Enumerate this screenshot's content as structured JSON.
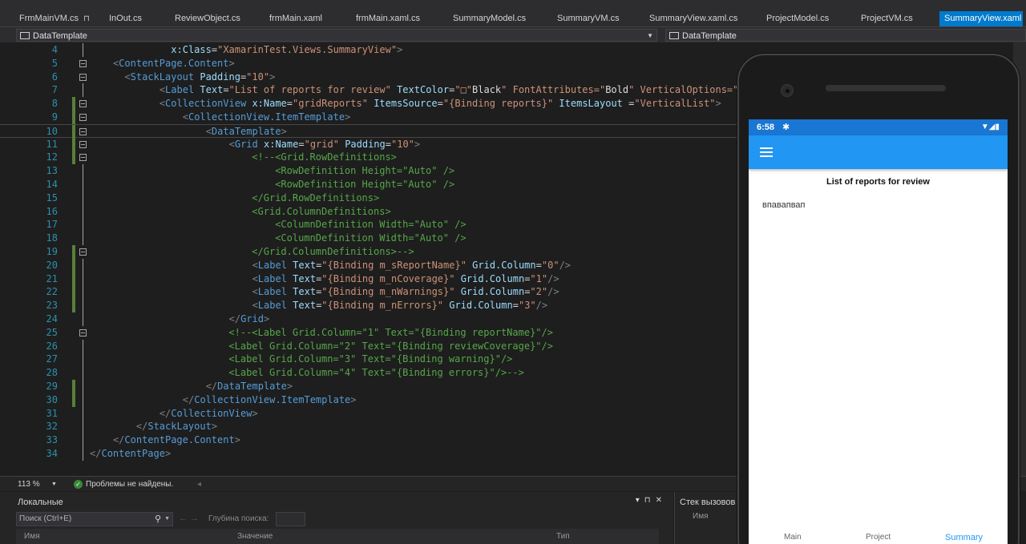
{
  "tabs": [
    {
      "label": "FrmMainVM.cs",
      "pin": "⊓"
    },
    {
      "label": "InOut.cs"
    },
    {
      "label": "ReviewObject.cs"
    },
    {
      "label": "frmMain.xaml"
    },
    {
      "label": "frmMain.xaml.cs"
    },
    {
      "label": "SummaryModel.cs"
    },
    {
      "label": "SummaryVM.cs"
    },
    {
      "label": "SummaryView.xaml.cs"
    },
    {
      "label": "ProjectModel.cs"
    },
    {
      "label": "ProjectVM.cs"
    },
    {
      "label": "SummaryView.xaml",
      "active": true
    }
  ],
  "navbar": {
    "left": "DataTemplate",
    "right": "DataTemplate"
  },
  "editor": {
    "current_line": 10,
    "lines": [
      {
        "n": "4",
        "code": "              x:Class=\"XamarinTest.Views.SummaryView\">"
      },
      {
        "n": "5",
        "code": "    <ContentPage.Content>"
      },
      {
        "n": "6",
        "code": "      <StackLayout Padding=\"10\">"
      },
      {
        "n": "7",
        "code": "            <Label Text=\"List of reports for review\" TextColor=\"□\"Black\" FontAttributes=\"Bold\" VerticalOptions=\"Sta"
      },
      {
        "n": "8",
        "code": "            <CollectionView x:Name=\"gridReports\" ItemsSource=\"{Binding reports}\" ItemsLayout =\"VerticalList\">"
      },
      {
        "n": "9",
        "code": "                <CollectionView.ItemTemplate>"
      },
      {
        "n": "10",
        "code": "                    <DataTemplate>"
      },
      {
        "n": "11",
        "code": "                        <Grid x:Name=\"grid\" Padding=\"10\">"
      },
      {
        "n": "12",
        "code": "                            <!--<Grid.RowDefinitions>"
      },
      {
        "n": "13",
        "code": "                                <RowDefinition Height=\"Auto\" />"
      },
      {
        "n": "14",
        "code": "                                <RowDefinition Height=\"Auto\" />"
      },
      {
        "n": "15",
        "code": "                            </Grid.RowDefinitions>"
      },
      {
        "n": "16",
        "code": "                            <Grid.ColumnDefinitions>"
      },
      {
        "n": "17",
        "code": "                                <ColumnDefinition Width=\"Auto\" />"
      },
      {
        "n": "18",
        "code": "                                <ColumnDefinition Width=\"Auto\" />"
      },
      {
        "n": "19",
        "code": "                            </Grid.ColumnDefinitions>-->"
      },
      {
        "n": "20",
        "code": "                            <Label Text=\"{Binding m_sReportName}\" Grid.Column=\"0\"/>"
      },
      {
        "n": "21",
        "code": "                            <Label Text=\"{Binding m_nCoverage}\" Grid.Column=\"1\"/>"
      },
      {
        "n": "22",
        "code": "                            <Label Text=\"{Binding m_nWarnings}\" Grid.Column=\"2\"/>"
      },
      {
        "n": "23",
        "code": "                            <Label Text=\"{Binding m_nErrors}\" Grid.Column=\"3\"/>"
      },
      {
        "n": "24",
        "code": "                        </Grid>"
      },
      {
        "n": "25",
        "code": "                        <!--<Label Grid.Column=\"1\" Text=\"{Binding reportName}\"/>"
      },
      {
        "n": "26",
        "code": "                        <Label Grid.Column=\"2\" Text=\"{Binding reviewCoverage}\"/>"
      },
      {
        "n": "27",
        "code": "                        <Label Grid.Column=\"3\" Text=\"{Binding warning}\"/>"
      },
      {
        "n": "28",
        "code": "                        <Label Grid.Column=\"4\" Text=\"{Binding errors}\"/>-->"
      },
      {
        "n": "29",
        "code": "                    </DataTemplate>"
      },
      {
        "n": "30",
        "code": "                </CollectionView.ItemTemplate>"
      },
      {
        "n": "31",
        "code": "            </CollectionView>"
      },
      {
        "n": "32",
        "code": "        </StackLayout>"
      },
      {
        "n": "33",
        "code": "    </ContentPage.Content>"
      },
      {
        "n": "34",
        "code": "</ContentPage>"
      }
    ]
  },
  "status": {
    "zoom": "113 %",
    "issues": "Проблемы не найдены."
  },
  "locals": {
    "title": "Локальные",
    "search_placeholder": "Поиск (Ctrl+E)",
    "depth_label": "Глубина поиска:",
    "col_name": "Имя",
    "col_value": "Значение",
    "col_type": "Тип"
  },
  "callstack": {
    "title": "Стек вызовов",
    "col_name": "Имя"
  },
  "phone": {
    "time": "6:58",
    "heading": "List of reports for review",
    "item": "впавапвап",
    "bottom_tabs": [
      {
        "label": "Main"
      },
      {
        "label": "Project"
      },
      {
        "label": "Summary",
        "selected": true
      }
    ]
  }
}
